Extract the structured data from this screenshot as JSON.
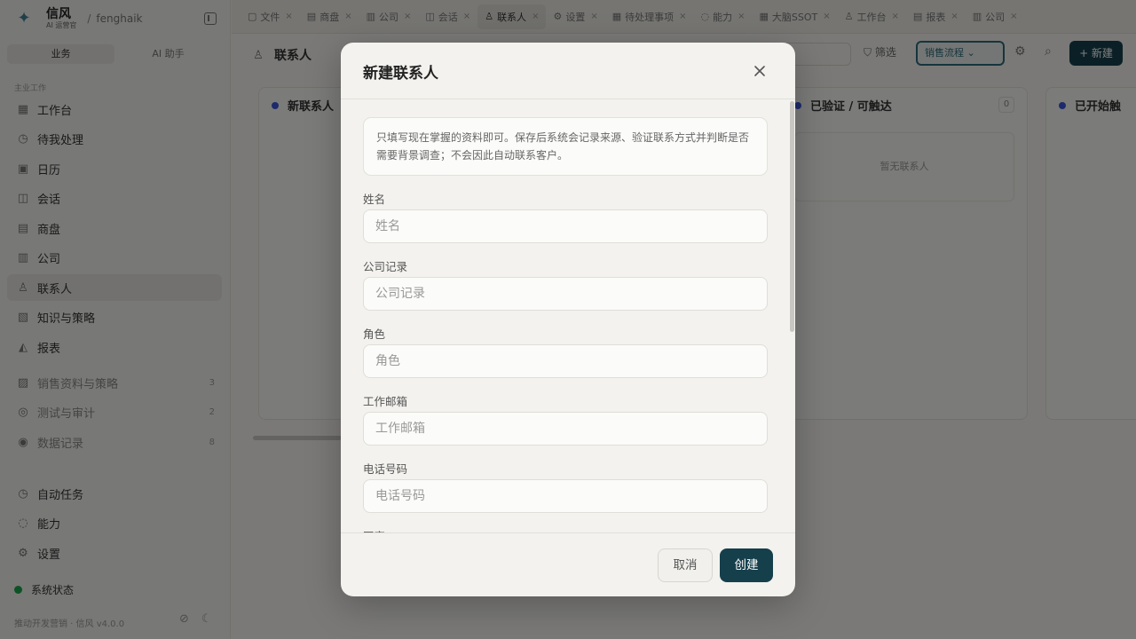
{
  "app": {
    "brand_name": "信风",
    "brand_sub": "AI 运营官",
    "separator": "/",
    "user": "fenghaik",
    "mode_tabs": [
      "业务",
      "AI 助手"
    ],
    "section_label": "主业工作",
    "nav_items": [
      {
        "icon": "▦",
        "label": "工作台"
      },
      {
        "icon": "◷",
        "label": "待我处理"
      },
      {
        "icon": "▣",
        "label": "日历"
      },
      {
        "icon": "◫",
        "label": "会话"
      },
      {
        "icon": "▤",
        "label": "商盘"
      },
      {
        "icon": "▥",
        "label": "公司"
      },
      {
        "icon": "♙",
        "label": "联系人"
      },
      {
        "icon": "▧",
        "label": "知识与策略"
      },
      {
        "icon": "◭",
        "label": "报表"
      }
    ],
    "nav_groups": [
      {
        "icon": "▨",
        "label": "销售资料与策略",
        "count": "3"
      },
      {
        "icon": "◎",
        "label": "测试与审计",
        "count": "2"
      },
      {
        "icon": "◉",
        "label": "数据记录",
        "count": "8"
      }
    ],
    "nav_bottom": [
      {
        "icon": "◷",
        "label": "自动任务"
      },
      {
        "icon": "◌",
        "label": "能力"
      },
      {
        "icon": "⚙",
        "label": "设置"
      }
    ],
    "status": "系统状态",
    "footer": "推动开发营销 · 信风 v4.0.0"
  },
  "tabs": [
    {
      "icon": "▢",
      "label": "文件"
    },
    {
      "icon": "▤",
      "label": "商盘"
    },
    {
      "icon": "▥",
      "label": "公司"
    },
    {
      "icon": "◫",
      "label": "会话"
    },
    {
      "icon": "♙",
      "label": "联系人"
    },
    {
      "icon": "⚙",
      "label": "设置"
    },
    {
      "icon": "▦",
      "label": "待处理事项"
    },
    {
      "icon": "◌",
      "label": "能力"
    },
    {
      "icon": "▦",
      "label": "大脑SSOT"
    },
    {
      "icon": "♙",
      "label": "工作台"
    },
    {
      "icon": "▤",
      "label": "报表"
    },
    {
      "icon": "▥",
      "label": "公司"
    }
  ],
  "page": {
    "title": "联系人",
    "filter": "筛选",
    "sales_select": "销售流程",
    "new_button": "+ 新建",
    "columns": [
      {
        "title": "新联系人",
        "count": "0",
        "empty": ""
      },
      {
        "title": "已验证 / 可触达",
        "count": "0",
        "empty": "暂无联系人"
      },
      {
        "title": "已开始触",
        "count": "",
        "empty": ""
      }
    ]
  },
  "modal": {
    "title": "新建联系人",
    "notice": "只填写现在掌握的资料即可。保存后系统会记录来源、验证联系方式并判断是否需要背景调查；不会因此自动联系客户。",
    "fields": [
      {
        "label": "姓名",
        "placeholder": "姓名",
        "value": ""
      },
      {
        "label": "公司记录",
        "placeholder": "公司记录",
        "value": ""
      },
      {
        "label": "角色",
        "placeholder": "角色",
        "value": ""
      },
      {
        "label": "工作邮箱",
        "placeholder": "工作邮箱",
        "value": ""
      },
      {
        "label": "电话号码",
        "placeholder": "电话号码",
        "value": ""
      },
      {
        "label": "国家",
        "placeholder": "",
        "value": ""
      }
    ],
    "cancel": "取消",
    "create": "创建"
  },
  "colors": {
    "primary": "#163f4c",
    "status_green": "#1aa54a",
    "column_dot": "#3b55d9"
  }
}
